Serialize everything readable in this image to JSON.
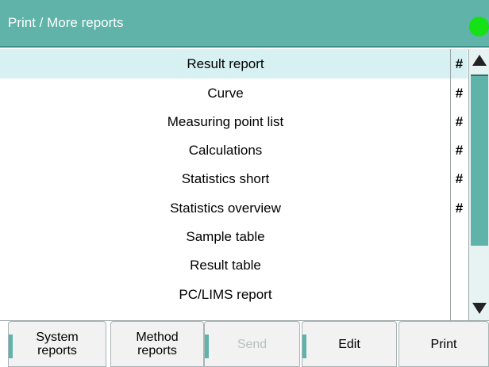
{
  "header": {
    "title": "Print / More reports",
    "status_color": "#16e016"
  },
  "reports": [
    {
      "label": "Result report",
      "mark": "#",
      "selected": true
    },
    {
      "label": "Curve",
      "mark": "#"
    },
    {
      "label": "Measuring point list",
      "mark": "#"
    },
    {
      "label": "Calculations",
      "mark": "#"
    },
    {
      "label": "Statistics short",
      "mark": "#"
    },
    {
      "label": "Statistics overview",
      "mark": "#"
    },
    {
      "label": "Sample table",
      "mark": ""
    },
    {
      "label": "Result table",
      "mark": ""
    },
    {
      "label": "PC/LIMS report",
      "mark": ""
    }
  ],
  "scrollbar": {
    "up_icon": "triangle-up-icon",
    "down_icon": "triangle-down-icon"
  },
  "softkeys": {
    "system_reports": "System\nreports",
    "method_reports": "Method\nreports",
    "send": "Send",
    "edit": "Edit",
    "print": "Print"
  },
  "colors": {
    "accent": "#5fb3a9",
    "selection": "#d7f1f2"
  }
}
